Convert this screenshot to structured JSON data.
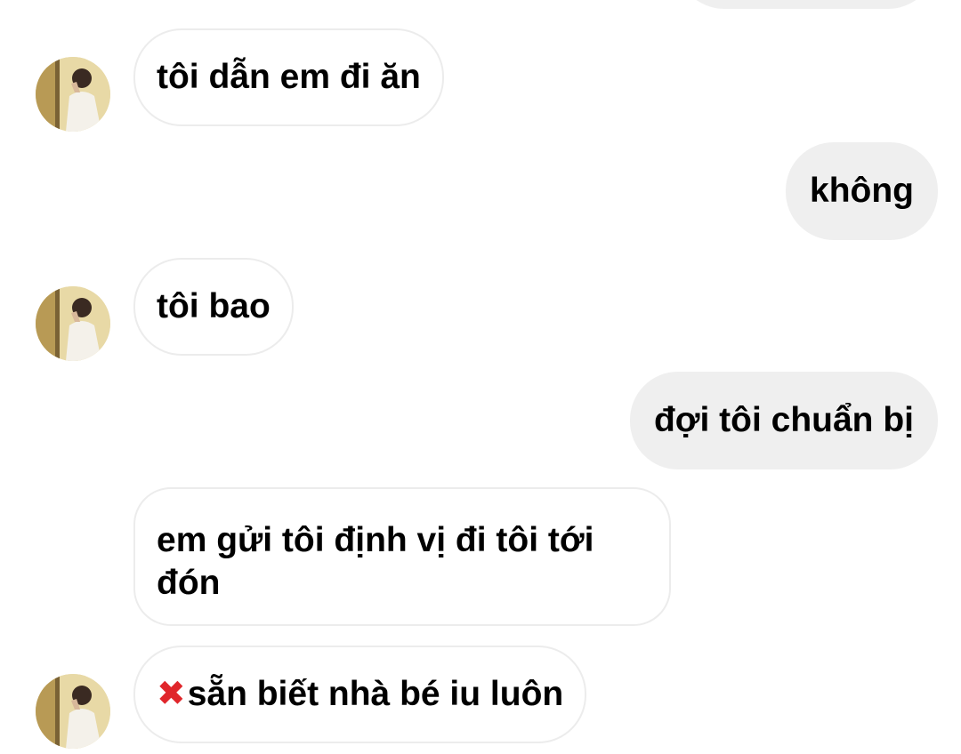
{
  "messages": [
    {
      "side": "in",
      "text": "tôi dẫn em đi ăn",
      "avatar": true
    },
    {
      "side": "out",
      "text": "không"
    },
    {
      "side": "in",
      "text": "tôi bao",
      "avatar": true
    },
    {
      "side": "out",
      "text": "đợi tôi chuẩn bị"
    },
    {
      "side": "in",
      "text": "em gửi tôi định vị đi tôi tới đón",
      "avatar": false
    },
    {
      "side": "in",
      "emoji": "cross-mark-emoji",
      "text": "sẵn biết nhà bé iu luôn",
      "avatar": true
    }
  ],
  "colors": {
    "incoming_bg": "#ffffff",
    "incoming_border": "#ececec",
    "outgoing_bg": "#efefef",
    "text": "#000000",
    "cross_mark": "#e0262b"
  }
}
